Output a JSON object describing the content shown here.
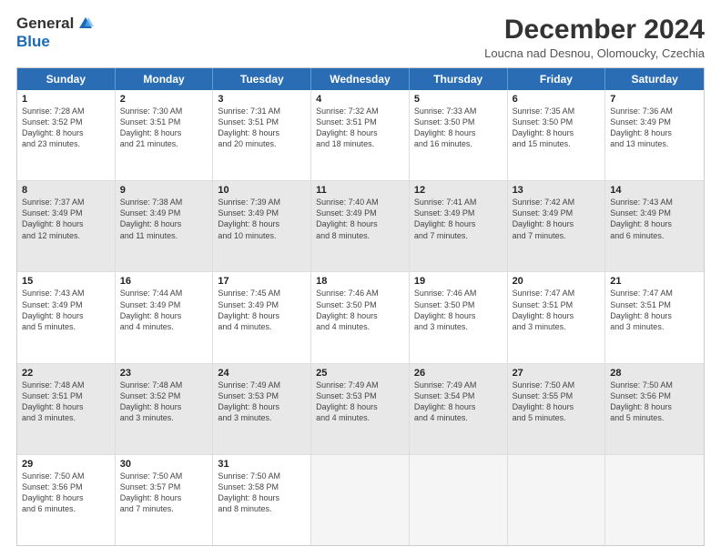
{
  "logo": {
    "general": "General",
    "blue": "Blue"
  },
  "title": "December 2024",
  "subtitle": "Loucna nad Desnou, Olomoucky, Czechia",
  "days": [
    "Sunday",
    "Monday",
    "Tuesday",
    "Wednesday",
    "Thursday",
    "Friday",
    "Saturday"
  ],
  "weeks": [
    [
      {
        "day": "1",
        "lines": [
          "Sunrise: 7:28 AM",
          "Sunset: 3:52 PM",
          "Daylight: 8 hours",
          "and 23 minutes."
        ]
      },
      {
        "day": "2",
        "lines": [
          "Sunrise: 7:30 AM",
          "Sunset: 3:51 PM",
          "Daylight: 8 hours",
          "and 21 minutes."
        ]
      },
      {
        "day": "3",
        "lines": [
          "Sunrise: 7:31 AM",
          "Sunset: 3:51 PM",
          "Daylight: 8 hours",
          "and 20 minutes."
        ]
      },
      {
        "day": "4",
        "lines": [
          "Sunrise: 7:32 AM",
          "Sunset: 3:51 PM",
          "Daylight: 8 hours",
          "and 18 minutes."
        ]
      },
      {
        "day": "5",
        "lines": [
          "Sunrise: 7:33 AM",
          "Sunset: 3:50 PM",
          "Daylight: 8 hours",
          "and 16 minutes."
        ]
      },
      {
        "day": "6",
        "lines": [
          "Sunrise: 7:35 AM",
          "Sunset: 3:50 PM",
          "Daylight: 8 hours",
          "and 15 minutes."
        ]
      },
      {
        "day": "7",
        "lines": [
          "Sunrise: 7:36 AM",
          "Sunset: 3:49 PM",
          "Daylight: 8 hours",
          "and 13 minutes."
        ]
      }
    ],
    [
      {
        "day": "8",
        "lines": [
          "Sunrise: 7:37 AM",
          "Sunset: 3:49 PM",
          "Daylight: 8 hours",
          "and 12 minutes."
        ],
        "shaded": true
      },
      {
        "day": "9",
        "lines": [
          "Sunrise: 7:38 AM",
          "Sunset: 3:49 PM",
          "Daylight: 8 hours",
          "and 11 minutes."
        ],
        "shaded": true
      },
      {
        "day": "10",
        "lines": [
          "Sunrise: 7:39 AM",
          "Sunset: 3:49 PM",
          "Daylight: 8 hours",
          "and 10 minutes."
        ],
        "shaded": true
      },
      {
        "day": "11",
        "lines": [
          "Sunrise: 7:40 AM",
          "Sunset: 3:49 PM",
          "Daylight: 8 hours",
          "and 8 minutes."
        ],
        "shaded": true
      },
      {
        "day": "12",
        "lines": [
          "Sunrise: 7:41 AM",
          "Sunset: 3:49 PM",
          "Daylight: 8 hours",
          "and 7 minutes."
        ],
        "shaded": true
      },
      {
        "day": "13",
        "lines": [
          "Sunrise: 7:42 AM",
          "Sunset: 3:49 PM",
          "Daylight: 8 hours",
          "and 7 minutes."
        ],
        "shaded": true
      },
      {
        "day": "14",
        "lines": [
          "Sunrise: 7:43 AM",
          "Sunset: 3:49 PM",
          "Daylight: 8 hours",
          "and 6 minutes."
        ],
        "shaded": true
      }
    ],
    [
      {
        "day": "15",
        "lines": [
          "Sunrise: 7:43 AM",
          "Sunset: 3:49 PM",
          "Daylight: 8 hours",
          "and 5 minutes."
        ]
      },
      {
        "day": "16",
        "lines": [
          "Sunrise: 7:44 AM",
          "Sunset: 3:49 PM",
          "Daylight: 8 hours",
          "and 4 minutes."
        ]
      },
      {
        "day": "17",
        "lines": [
          "Sunrise: 7:45 AM",
          "Sunset: 3:49 PM",
          "Daylight: 8 hours",
          "and 4 minutes."
        ]
      },
      {
        "day": "18",
        "lines": [
          "Sunrise: 7:46 AM",
          "Sunset: 3:50 PM",
          "Daylight: 8 hours",
          "and 4 minutes."
        ]
      },
      {
        "day": "19",
        "lines": [
          "Sunrise: 7:46 AM",
          "Sunset: 3:50 PM",
          "Daylight: 8 hours",
          "and 3 minutes."
        ]
      },
      {
        "day": "20",
        "lines": [
          "Sunrise: 7:47 AM",
          "Sunset: 3:51 PM",
          "Daylight: 8 hours",
          "and 3 minutes."
        ]
      },
      {
        "day": "21",
        "lines": [
          "Sunrise: 7:47 AM",
          "Sunset: 3:51 PM",
          "Daylight: 8 hours",
          "and 3 minutes."
        ]
      }
    ],
    [
      {
        "day": "22",
        "lines": [
          "Sunrise: 7:48 AM",
          "Sunset: 3:51 PM",
          "Daylight: 8 hours",
          "and 3 minutes."
        ],
        "shaded": true
      },
      {
        "day": "23",
        "lines": [
          "Sunrise: 7:48 AM",
          "Sunset: 3:52 PM",
          "Daylight: 8 hours",
          "and 3 minutes."
        ],
        "shaded": true
      },
      {
        "day": "24",
        "lines": [
          "Sunrise: 7:49 AM",
          "Sunset: 3:53 PM",
          "Daylight: 8 hours",
          "and 3 minutes."
        ],
        "shaded": true
      },
      {
        "day": "25",
        "lines": [
          "Sunrise: 7:49 AM",
          "Sunset: 3:53 PM",
          "Daylight: 8 hours",
          "and 4 minutes."
        ],
        "shaded": true
      },
      {
        "day": "26",
        "lines": [
          "Sunrise: 7:49 AM",
          "Sunset: 3:54 PM",
          "Daylight: 8 hours",
          "and 4 minutes."
        ],
        "shaded": true
      },
      {
        "day": "27",
        "lines": [
          "Sunrise: 7:50 AM",
          "Sunset: 3:55 PM",
          "Daylight: 8 hours",
          "and 5 minutes."
        ],
        "shaded": true
      },
      {
        "day": "28",
        "lines": [
          "Sunrise: 7:50 AM",
          "Sunset: 3:56 PM",
          "Daylight: 8 hours",
          "and 5 minutes."
        ],
        "shaded": true
      }
    ],
    [
      {
        "day": "29",
        "lines": [
          "Sunrise: 7:50 AM",
          "Sunset: 3:56 PM",
          "Daylight: 8 hours",
          "and 6 minutes."
        ]
      },
      {
        "day": "30",
        "lines": [
          "Sunrise: 7:50 AM",
          "Sunset: 3:57 PM",
          "Daylight: 8 hours",
          "and 7 minutes."
        ]
      },
      {
        "day": "31",
        "lines": [
          "Sunrise: 7:50 AM",
          "Sunset: 3:58 PM",
          "Daylight: 8 hours",
          "and 8 minutes."
        ]
      },
      {
        "day": "",
        "lines": [],
        "empty": true
      },
      {
        "day": "",
        "lines": [],
        "empty": true
      },
      {
        "day": "",
        "lines": [],
        "empty": true
      },
      {
        "day": "",
        "lines": [],
        "empty": true
      }
    ]
  ]
}
